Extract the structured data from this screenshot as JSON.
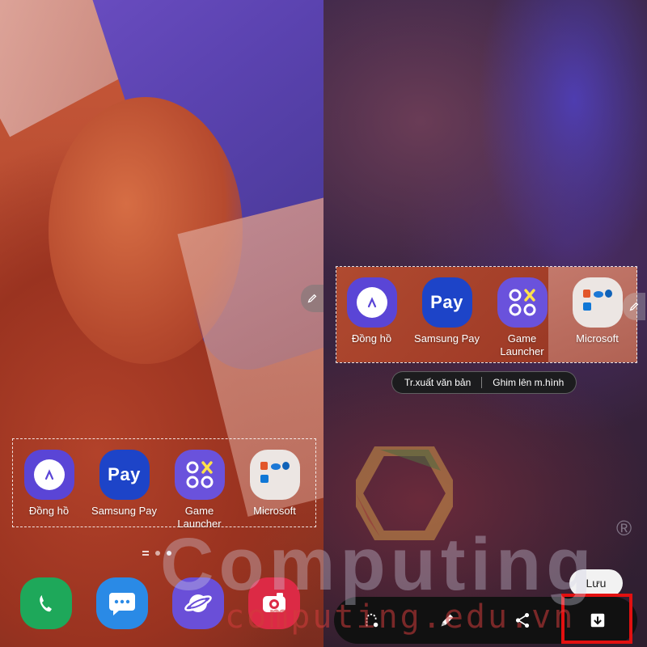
{
  "left_screen": {
    "selected_apps": [
      {
        "label": "Đồng hồ",
        "icon": "clock-icon"
      },
      {
        "label": "Samsung Pay",
        "icon": "samsung-pay-icon",
        "glyph": "Pay"
      },
      {
        "label": "Game Launcher",
        "icon": "game-launcher-icon"
      },
      {
        "label": "Microsoft",
        "icon": "microsoft-folder-icon"
      }
    ],
    "page_indicator": {
      "pages": 2,
      "current": 2
    },
    "dock": [
      {
        "icon": "phone-icon"
      },
      {
        "icon": "messages-icon"
      },
      {
        "icon": "internet-icon"
      },
      {
        "icon": "camera-icon"
      }
    ]
  },
  "right_screen": {
    "cropped_apps": [
      {
        "label": "Đồng hồ"
      },
      {
        "label": "Samsung Pay",
        "glyph": "Pay"
      },
      {
        "label": "Game Launcher"
      },
      {
        "label": "Microsoft"
      }
    ],
    "actions": {
      "extract_text": "Tr.xuất văn bản",
      "pin_to_screen": "Ghim lên m.hình"
    },
    "save_label": "Lưu",
    "toolbar": [
      {
        "icon": "lasso-select-icon"
      },
      {
        "icon": "pen-icon"
      },
      {
        "icon": "share-icon"
      },
      {
        "icon": "download-icon"
      }
    ]
  },
  "watermark": {
    "brand": "Computing",
    "url": "computing.edu.vn",
    "registered": "®"
  },
  "colors": {
    "highlight": "#e31010",
    "toolbar_bg": "#111111",
    "selection_border": "#ffffff"
  }
}
